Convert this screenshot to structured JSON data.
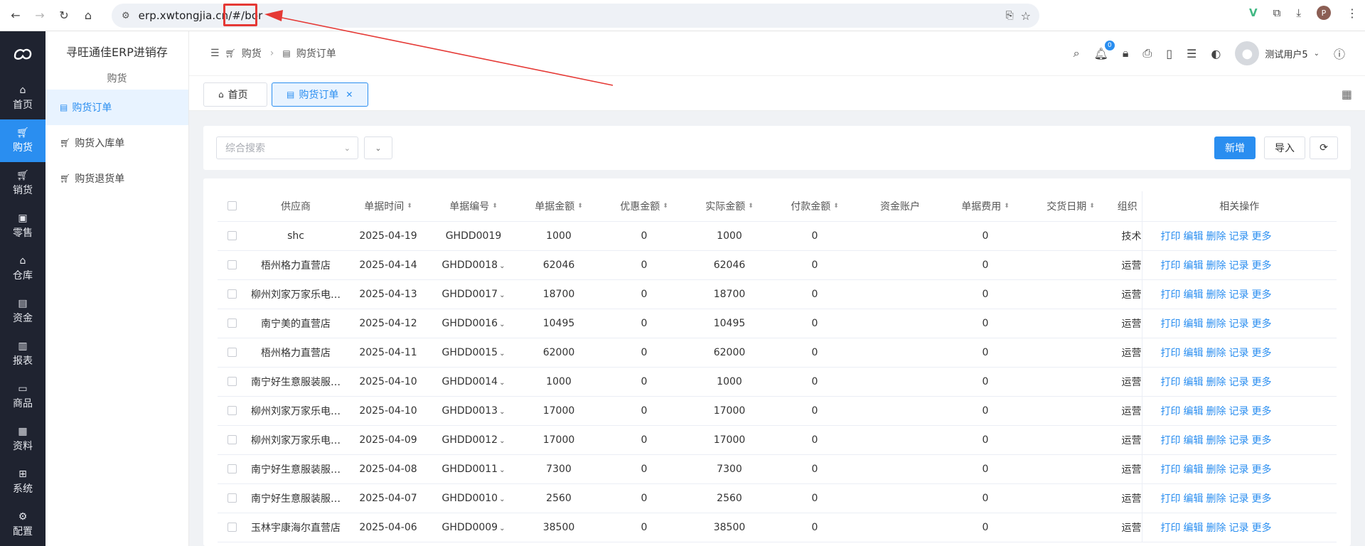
{
  "browser": {
    "url": "erp.xwtongjia.cn/#/bor",
    "profile_initial": "P"
  },
  "colors": {
    "accent": "#2a8ef0",
    "nav_bg": "#1f2330",
    "annotation": "#e53935"
  },
  "left_nav": [
    {
      "label": "首页",
      "icon": "home-icon",
      "glyph": "⌂"
    },
    {
      "label": "购货",
      "icon": "cart-icon",
      "glyph": "🛒︎",
      "active": true
    },
    {
      "label": "销货",
      "icon": "cart-sale-icon",
      "glyph": "🛒︎"
    },
    {
      "label": "零售",
      "icon": "bag-icon",
      "glyph": "▣"
    },
    {
      "label": "仓库",
      "icon": "warehouse-icon",
      "glyph": "⌂"
    },
    {
      "label": "资金",
      "icon": "money-icon",
      "glyph": "▤"
    },
    {
      "label": "报表",
      "icon": "report-icon",
      "glyph": "▥"
    },
    {
      "label": "商品",
      "icon": "goods-icon",
      "glyph": "▭"
    },
    {
      "label": "资料",
      "icon": "data-icon",
      "glyph": "▦"
    },
    {
      "label": "系统",
      "icon": "grid-icon",
      "glyph": "⊞"
    },
    {
      "label": "配置",
      "icon": "gear-icon",
      "glyph": "⚙"
    }
  ],
  "sub_nav": {
    "app_title": "寻旺通佳ERP进销存",
    "group": "购货",
    "items": [
      {
        "label": "购货订单",
        "active": true
      },
      {
        "label": "购货入库单"
      },
      {
        "label": "购货退货单"
      }
    ]
  },
  "header": {
    "breadcrumb": [
      "购货",
      "购货订单"
    ],
    "notification_count": "0",
    "user_name": "测试用户5"
  },
  "tabs": [
    {
      "label": "首页"
    },
    {
      "label": "购货订单",
      "active": true
    }
  ],
  "filter": {
    "search_placeholder": "综合搜索",
    "add_label": "新增",
    "import_label": "导入"
  },
  "table": {
    "columns": [
      "供应商",
      "单据时间",
      "单据编号",
      "单据金额",
      "优惠金额",
      "实际金额",
      "付款金额",
      "资金账户",
      "单据费用",
      "交货日期",
      "组织",
      "相关操作"
    ],
    "ops": [
      "打印",
      "编辑",
      "删除",
      "记录",
      "更多"
    ],
    "rows": [
      {
        "supplier": "shc",
        "date": "2025-04-19",
        "no": "GHDD0019",
        "amount": "1000",
        "discount": "0",
        "actual": "1000",
        "paid": "0",
        "account": "",
        "fee": "0",
        "delivery": "",
        "org": "技术"
      },
      {
        "supplier": "梧州格力直营店",
        "date": "2025-04-14",
        "no": "GHDD0018",
        "amount": "62046",
        "discount": "0",
        "actual": "62046",
        "paid": "0",
        "account": "",
        "fee": "0",
        "delivery": "",
        "org": "运营"
      },
      {
        "supplier": "柳州刘家万家乐电…",
        "date": "2025-04-13",
        "no": "GHDD0017",
        "amount": "18700",
        "discount": "0",
        "actual": "18700",
        "paid": "0",
        "account": "",
        "fee": "0",
        "delivery": "",
        "org": "运营"
      },
      {
        "supplier": "南宁美的直营店",
        "date": "2025-04-12",
        "no": "GHDD0016",
        "amount": "10495",
        "discount": "0",
        "actual": "10495",
        "paid": "0",
        "account": "",
        "fee": "0",
        "delivery": "",
        "org": "运营"
      },
      {
        "supplier": "梧州格力直营店",
        "date": "2025-04-11",
        "no": "GHDD0015",
        "amount": "62000",
        "discount": "0",
        "actual": "62000",
        "paid": "0",
        "account": "",
        "fee": "0",
        "delivery": "",
        "org": "运营"
      },
      {
        "supplier": "南宁好生意服装服…",
        "date": "2025-04-10",
        "no": "GHDD0014",
        "amount": "1000",
        "discount": "0",
        "actual": "1000",
        "paid": "0",
        "account": "",
        "fee": "0",
        "delivery": "",
        "org": "运营"
      },
      {
        "supplier": "柳州刘家万家乐电…",
        "date": "2025-04-10",
        "no": "GHDD0013",
        "amount": "17000",
        "discount": "0",
        "actual": "17000",
        "paid": "0",
        "account": "",
        "fee": "0",
        "delivery": "",
        "org": "运营"
      },
      {
        "supplier": "柳州刘家万家乐电…",
        "date": "2025-04-09",
        "no": "GHDD0012",
        "amount": "17000",
        "discount": "0",
        "actual": "17000",
        "paid": "0",
        "account": "",
        "fee": "0",
        "delivery": "",
        "org": "运营"
      },
      {
        "supplier": "南宁好生意服装服…",
        "date": "2025-04-08",
        "no": "GHDD0011",
        "amount": "7300",
        "discount": "0",
        "actual": "7300",
        "paid": "0",
        "account": "",
        "fee": "0",
        "delivery": "",
        "org": "运营"
      },
      {
        "supplier": "南宁好生意服装服…",
        "date": "2025-04-07",
        "no": "GHDD0010",
        "amount": "2560",
        "discount": "0",
        "actual": "2560",
        "paid": "0",
        "account": "",
        "fee": "0",
        "delivery": "",
        "org": "运营"
      },
      {
        "supplier": "玉林宇康海尔直营店",
        "date": "2025-04-06",
        "no": "GHDD0009",
        "amount": "38500",
        "discount": "0",
        "actual": "38500",
        "paid": "0",
        "account": "",
        "fee": "0",
        "delivery": "",
        "org": "运营"
      }
    ]
  }
}
